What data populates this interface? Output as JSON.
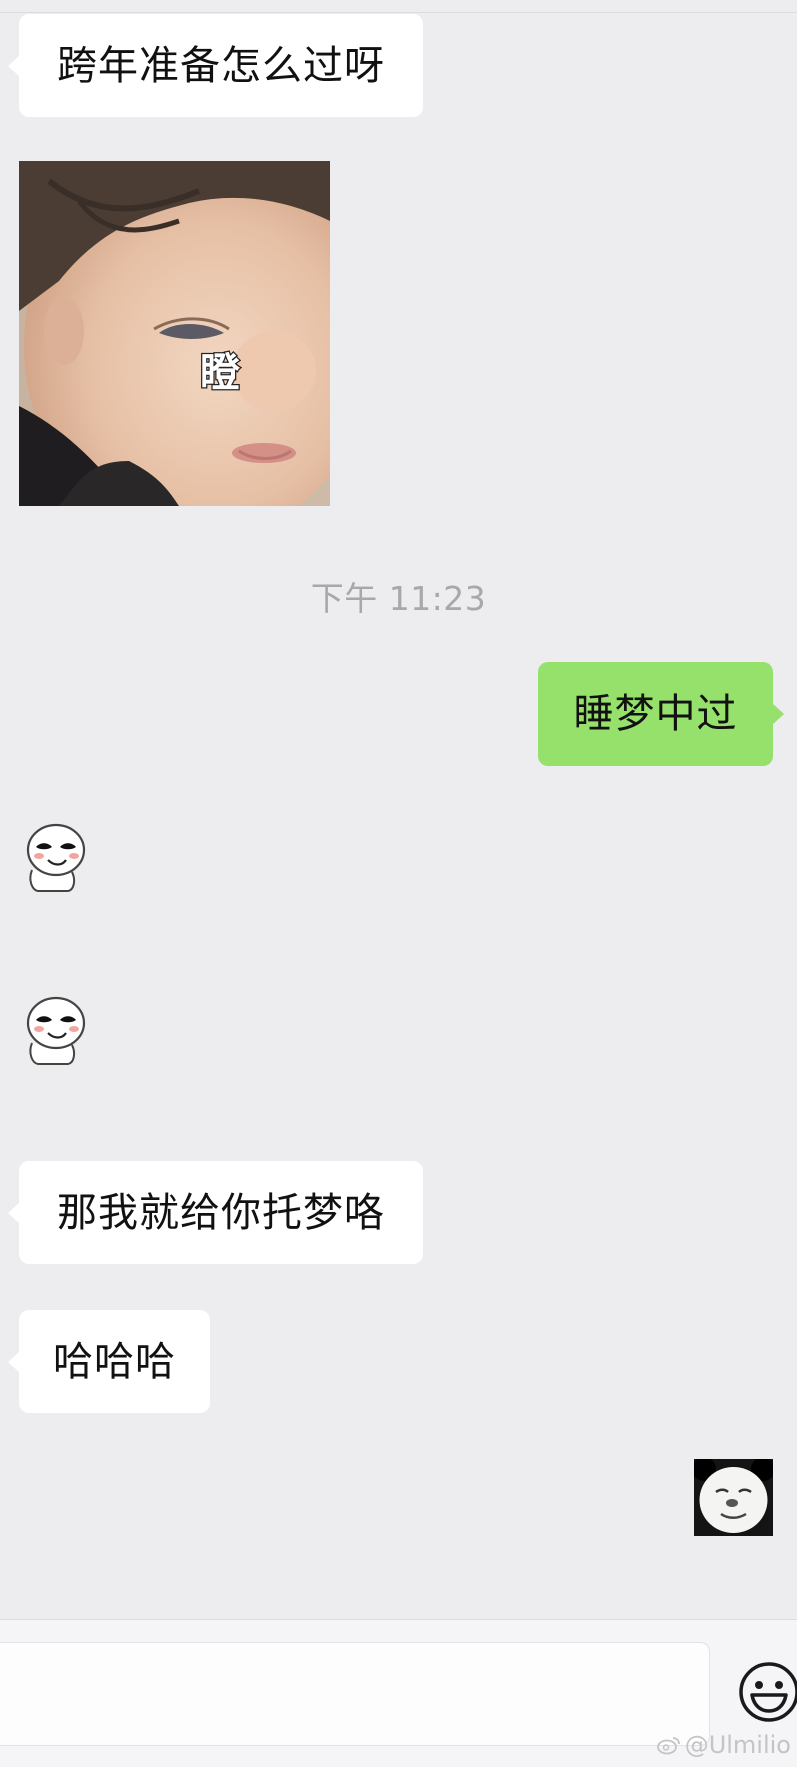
{
  "chat": {
    "messages": [
      {
        "text": "跨年准备怎么过呀"
      },
      {
        "overlay_text": "瞪"
      },
      {
        "text": "睡梦中过"
      },
      {
        "text": "那我就给你托梦咯"
      },
      {
        "text": "哈哈哈"
      }
    ],
    "timestamp": "下午 11:23"
  },
  "icons": {
    "emoji": "smiley-face-icon",
    "weibo": "weibo-icon"
  },
  "colors": {
    "background": "#ededf0",
    "incoming_bubble": "#ffffff",
    "outgoing_bubble": "#95e16b",
    "timestamp": "#a8a8ac"
  },
  "input_bar": {
    "message_value": ""
  },
  "watermark": {
    "text": "@Ulmilio"
  }
}
